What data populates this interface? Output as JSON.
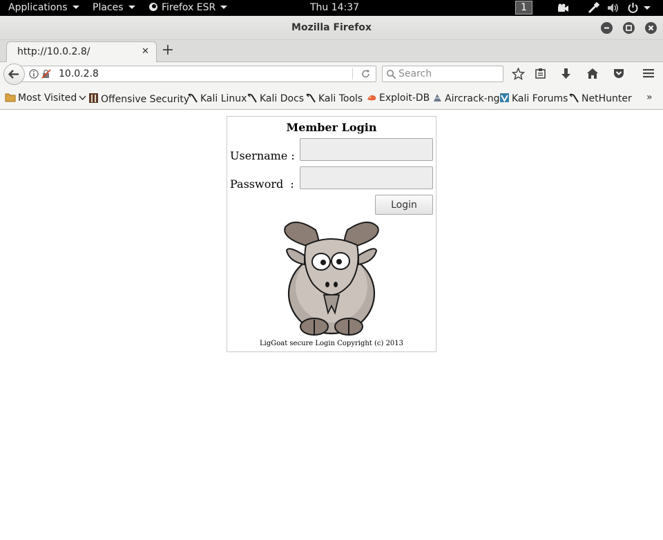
{
  "topbar": {
    "applications": "Applications",
    "places": "Places",
    "browser_menu": "Firefox ESR",
    "clock": "Thu 14:37",
    "workspace": "1"
  },
  "window": {
    "title": "Mozilla Firefox"
  },
  "tab": {
    "title": "http://10.0.2.8/",
    "close": "✕",
    "new_tab": "+"
  },
  "navbar": {
    "url": "10.0.2.8",
    "search_placeholder": "Search"
  },
  "bookmarks": {
    "items": [
      "Most Visited",
      "Offensive Security",
      "Kali Linux",
      "Kali Docs",
      "Kali Tools",
      "Exploit-DB",
      "Aircrack-ng",
      "Kali Forums",
      "NetHunter"
    ],
    "more": "»"
  },
  "login": {
    "heading": "Member Login",
    "username_label": "Username :",
    "password_label": "Password  :",
    "username_value": "",
    "password_value": "",
    "button": "Login",
    "copyright": "LigGoat secure Login Copyright (c) 2013"
  },
  "colors": {
    "topbar_bg": "#000000",
    "chrome_bg": "#f4f4f3",
    "accent_orange": "#e8643a"
  }
}
